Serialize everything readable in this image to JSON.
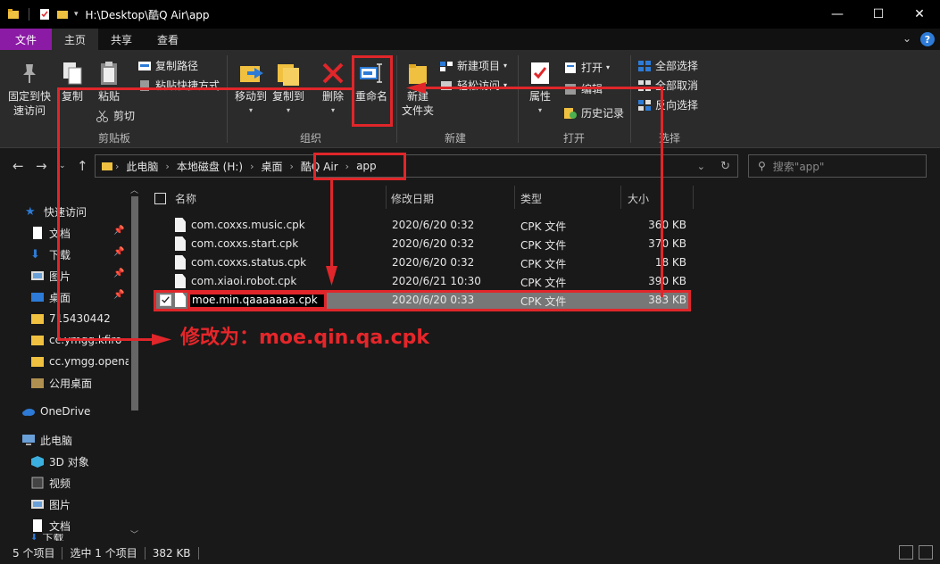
{
  "titlebar": {
    "path": "H:\\Desktop\\酷Q Air\\app",
    "minimize": "—",
    "maximize": "☐",
    "close": "✕"
  },
  "tabs": {
    "file": "文件",
    "home": "主页",
    "share": "共享",
    "view": "查看"
  },
  "ribbon": {
    "pin": "固定到快\n速访问",
    "copy": "复制",
    "paste": "粘贴",
    "copy_path": "复制路径",
    "paste_shortcut": "粘贴快捷方式",
    "cut": "剪切",
    "clipboard_group": "剪贴板",
    "move_to": "移动到",
    "copy_to": "复制到",
    "delete": "删除",
    "rename": "重命名",
    "organize_group": "组织",
    "new_folder": "新建\n文件夹",
    "new_item": "新建项目",
    "easy_access": "轻松访问",
    "new_group": "新建",
    "properties": "属性",
    "open": "打开",
    "edit": "编辑",
    "history": "历史记录",
    "open_group": "打开",
    "select_all": "全部选择",
    "select_none": "全部取消",
    "invert_selection": "反向选择",
    "select_group": "选择"
  },
  "address": {
    "crumbs": [
      "此电脑",
      "本地磁盘 (H:)",
      "桌面",
      "酷Q Air",
      "app"
    ],
    "search_placeholder": "搜索\"app\""
  },
  "nav": {
    "quick_access": "快速访问",
    "documents": "文档",
    "downloads": "下载",
    "pictures": "图片",
    "desktop": "桌面",
    "folder1": "715430442",
    "folder2": "cc.ymgg.kfiro",
    "folder3": "cc.ymgg.opena",
    "public_desktop": "公用桌面",
    "onedrive": "OneDrive",
    "this_pc": "此电脑",
    "objects3d": "3D 对象",
    "videos": "视频",
    "pictures2": "图片",
    "documents2": "文档",
    "downloads2": "下载"
  },
  "columns": {
    "name": "名称",
    "modified": "修改日期",
    "type": "类型",
    "size": "大小"
  },
  "files": [
    {
      "name": "com.coxxs.music.cpk",
      "modified": "2020/6/20 0:32",
      "type": "CPK 文件",
      "size": "360 KB"
    },
    {
      "name": "com.coxxs.start.cpk",
      "modified": "2020/6/20 0:32",
      "type": "CPK 文件",
      "size": "370 KB"
    },
    {
      "name": "com.coxxs.status.cpk",
      "modified": "2020/6/20 0:32",
      "type": "CPK 文件",
      "size": "18 KB"
    },
    {
      "name": "com.xiaoi.robot.cpk",
      "modified": "2020/6/21 10:30",
      "type": "CPK 文件",
      "size": "390 KB"
    },
    {
      "name": "moe.min.qaaaaaaa.cpk",
      "modified": "2020/6/20 0:33",
      "type": "CPK 文件",
      "size": "383 KB"
    }
  ],
  "status": {
    "count": "5 个项目",
    "selected": "选中 1 个项目",
    "size": "382 KB"
  },
  "annotation": {
    "text": "修改为：moe.qin.qa.cpk",
    "color": "#e0262a"
  },
  "colors": {
    "file_tab": "#8b1aa5",
    "accent_blue": "#2d7bd6",
    "folder": "#f0c040"
  }
}
